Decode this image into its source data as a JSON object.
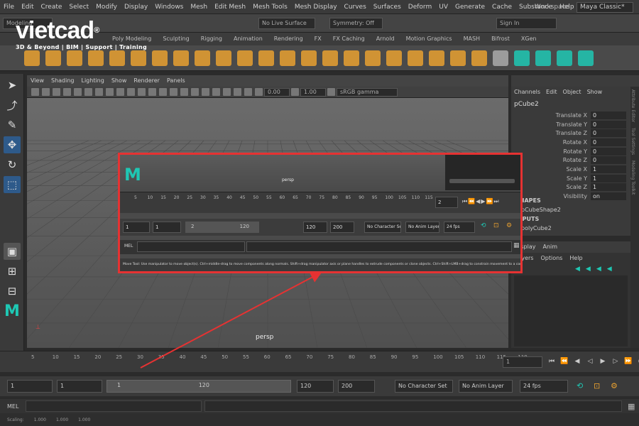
{
  "menubar": {
    "items": [
      "File",
      "Edit",
      "Create",
      "Select",
      "Modify",
      "Display",
      "Windows",
      "Mesh",
      "Edit Mesh",
      "Mesh Tools",
      "Mesh Display",
      "Curves",
      "Surfaces",
      "Deform",
      "UV",
      "Generate",
      "Cache",
      "Substance",
      "Help"
    ],
    "workspace_label": "Workspace :",
    "workspace_value": "Maya Classic*"
  },
  "statusline": {
    "mode": "Modeling",
    "live_surface": "No Live Surface",
    "symmetry": "Symmetry: Off",
    "sign_in": "Sign In"
  },
  "logo": {
    "name": "vietcad",
    "registered": "®",
    "tagline": "3D & Beyond | BIM | Support | Training"
  },
  "shelf_tabs": [
    "Poly Modeling",
    "Sculpting",
    "Rigging",
    "Animation",
    "Rendering",
    "FX",
    "FX Caching",
    "Arnold",
    "Motion Graphics",
    "MASH",
    "Bifrost",
    "XGen"
  ],
  "viewport": {
    "menu": [
      "View",
      "Shading",
      "Lighting",
      "Show",
      "Renderer",
      "Panels"
    ],
    "exposure": "0.00",
    "gamma": "1.00",
    "color_space": "sRGB gamma",
    "camera_label": "persp"
  },
  "channel_box": {
    "menu": [
      "Channels",
      "Edit",
      "Object",
      "Show"
    ],
    "object": "pCube2",
    "attributes": [
      {
        "label": "Translate X",
        "value": "0"
      },
      {
        "label": "Translate Y",
        "value": "0"
      },
      {
        "label": "Translate Z",
        "value": "0"
      },
      {
        "label": "Rotate X",
        "value": "0"
      },
      {
        "label": "Rotate Y",
        "value": "0"
      },
      {
        "label": "Rotate Z",
        "value": "0"
      },
      {
        "label": "Scale X",
        "value": "1"
      },
      {
        "label": "Scale Y",
        "value": "1"
      },
      {
        "label": "Scale Z",
        "value": "1"
      },
      {
        "label": "Visibility",
        "value": "on"
      }
    ],
    "shapes_header": "SHAPES",
    "shape": "pCubeShape2",
    "inputs_header": "INPUTS",
    "input": "polyCube2"
  },
  "layers": {
    "tabs": [
      "Display",
      "Anim"
    ],
    "menu": [
      "Layers",
      "Options",
      "Help"
    ]
  },
  "side_tabs": [
    "Attribute Editor",
    "Tool Settings",
    "Modeling Toolkit"
  ],
  "timeline": {
    "ticks": [
      "5",
      "10",
      "15",
      "20",
      "25",
      "30",
      "35",
      "40",
      "45",
      "50",
      "55",
      "60",
      "65",
      "70",
      "75",
      "80",
      "85",
      "90",
      "95",
      "100",
      "105",
      "110",
      "115",
      "119"
    ],
    "current_frame": "1"
  },
  "range": {
    "start": "1",
    "playback_start": "1",
    "slider_start": "1",
    "slider_end": "120",
    "playback_end": "120",
    "end": "200",
    "character_set": "No Character Set",
    "anim_layer": "No Anim Layer",
    "fps": "24 fps"
  },
  "mel": {
    "label": "MEL"
  },
  "help_line": {
    "text": "Scaling: 1.000  1.000  1.000",
    "scale_x": "1.000",
    "scale_y": "1.000",
    "scale_z": "1.000",
    "label": "Scaling:"
  },
  "inset": {
    "persp": "persp",
    "ticks": [
      "5",
      "10",
      "15",
      "20",
      "25",
      "30",
      "35",
      "40",
      "45",
      "50",
      "55",
      "60",
      "65",
      "70",
      "75",
      "80",
      "85",
      "90",
      "95",
      "100",
      "105",
      "110",
      "115"
    ],
    "current_frame": "2",
    "start": "1",
    "playback_start": "1",
    "slider_start": "2",
    "slider_end": "120",
    "playback_end": "120",
    "end": "200",
    "character_set": "No Character Set",
    "anim_layer": "No Anim Layer",
    "fps": "24 fps",
    "mel": "MEL",
    "help_text": "Move Tool: Use manipulator to move object(s). Ctrl+middle-drag to move components along normals. Shift+drag manipulator axis or plane handles to extrude components or clone objects. Ctrl+Shift+LMB+drag to constrain movement to a connected edge. Use D or INSERT to change the pivot..."
  },
  "colors": {
    "highlight_border": "#e63232",
    "maya_teal": "#1ec8b4",
    "icon_orange": "#e8a030",
    "active_blue": "#4a8fd8"
  }
}
